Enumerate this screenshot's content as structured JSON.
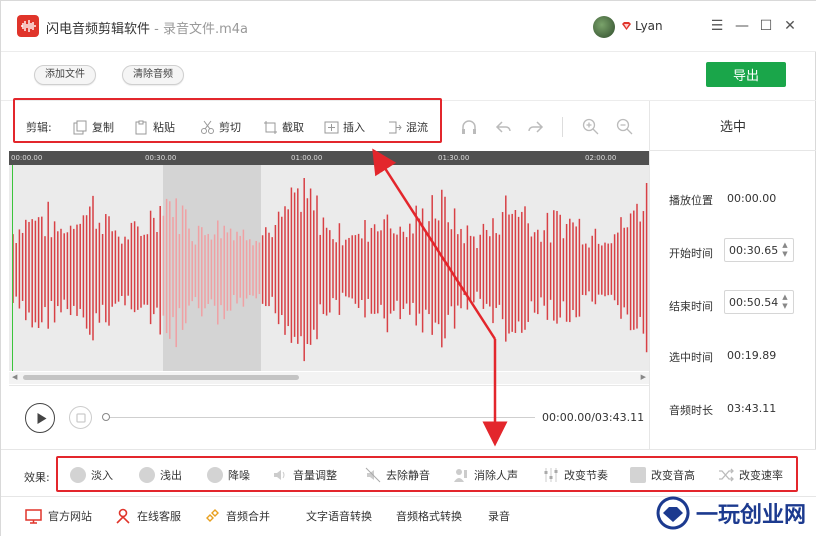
{
  "window": {
    "app_name": "闪电音频剪辑软件",
    "separator": " - ",
    "file_name": "录音文件.m4a",
    "user": "Lyan",
    "menu_glyph": "☰",
    "minimize_glyph": "—",
    "maximize_glyph": "☐",
    "close_glyph": "✕"
  },
  "topbar": {
    "add_file": "添加文件",
    "clear_audio": "清除音频",
    "export": "导出"
  },
  "editbar": {
    "label": "剪辑:",
    "copy": "复制",
    "paste": "粘贴",
    "cut": "剪切",
    "trim": "截取",
    "insert": "插入",
    "mix": "混流"
  },
  "ruler": {
    "ticks": [
      "00:00.00",
      "00:30.00",
      "01:00.00",
      "01:30.00",
      "02:00.00"
    ]
  },
  "panel": {
    "title": "选中",
    "play_position_label": "播放位置",
    "play_position": "00:00.00",
    "start_label": "开始时间",
    "start": "00:30.65",
    "end_label": "结束时间",
    "end": "00:50.54",
    "selection_label": "选中时间",
    "selection": "00:19.89",
    "duration_label": "音频时长",
    "duration": "03:43.11"
  },
  "transport": {
    "timecode": "00:00.00/03:43.11",
    "progress": 0
  },
  "effects": {
    "label": "效果:",
    "items": [
      "淡入",
      "浅出",
      "降噪",
      "音量调整",
      "去除静音",
      "消除人声",
      "改变节奏",
      "改变音高",
      "改变速率"
    ]
  },
  "bottombar": {
    "website": "官方网站",
    "support": "在线客服",
    "merge": "音频合并",
    "tts": "文字语音转换",
    "format": "音频格式转换",
    "record": "录音"
  },
  "watermark": "一玩创业网",
  "colors": {
    "accent_red": "#e0342a",
    "waveform": "#d84045",
    "waveform_selected": "#f0a0a3",
    "export_green": "#1aa64a",
    "highlight_red": "#e3262c"
  }
}
